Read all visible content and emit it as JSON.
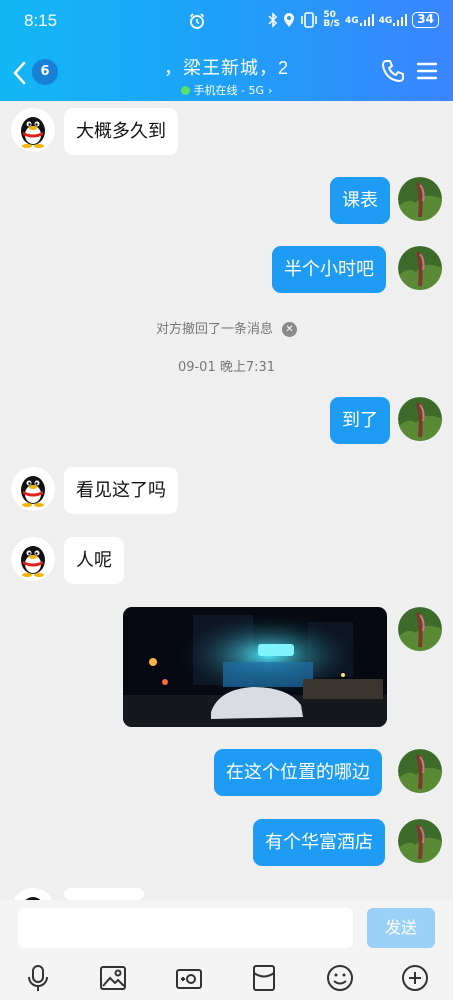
{
  "status_bar": {
    "time": "8:15",
    "net_speed_value": "50",
    "net_speed_unit": "B/S",
    "sig1": "4G",
    "sig2": "4G",
    "battery": "34"
  },
  "header": {
    "unread_count": "6",
    "title": "，梁王新城，2",
    "subtitle": "手机在线 - 5G",
    "subtitle_arrow": "›"
  },
  "messages": [
    {
      "side": "in",
      "text": "大概多久到"
    },
    {
      "side": "out",
      "text": "课表"
    },
    {
      "side": "out",
      "text": "半个小时吧"
    },
    {
      "side": "out",
      "text": "到了"
    },
    {
      "side": "in",
      "text": "看见这了吗"
    },
    {
      "side": "in",
      "text": "人呢"
    },
    {
      "side": "out",
      "text": "在这个位置的哪边"
    },
    {
      "side": "out",
      "text": "有个华富酒店"
    }
  ],
  "system": {
    "recall_notice": "对方撤回了一条消息",
    "timestamp": "09-01 晚上7:31"
  },
  "composer": {
    "send_label": "发送"
  },
  "colors": {
    "header_start": "#12b7f5",
    "header_end": "#3a84ff",
    "bubble_out": "#1e9bf2",
    "send_disabled": "#9bd1f8"
  }
}
